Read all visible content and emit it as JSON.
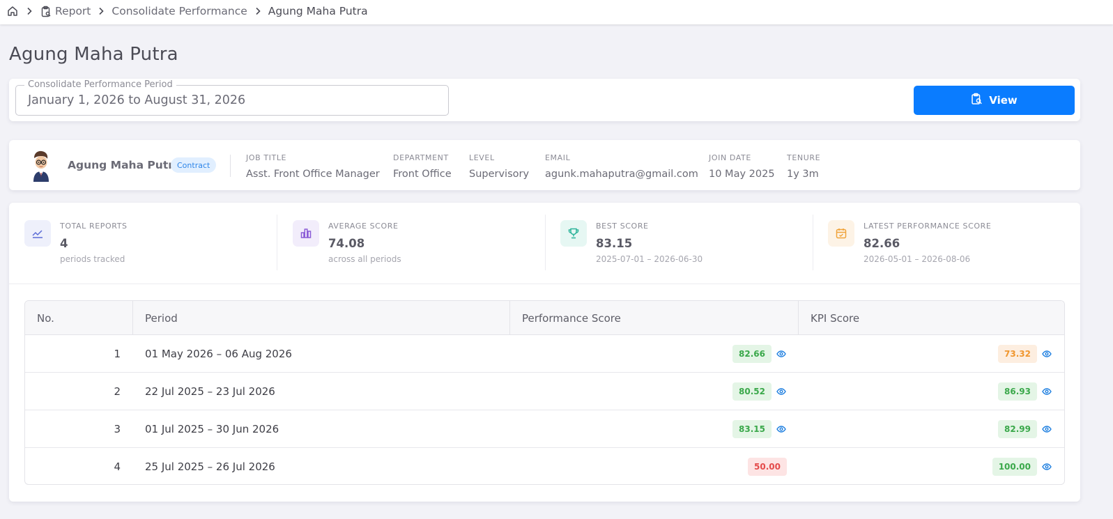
{
  "breadcrumb": {
    "items": [
      "Report",
      "Consolidate Performance",
      "Agung Maha Putra"
    ]
  },
  "page": {
    "title": "Agung Maha Putra"
  },
  "period_filter": {
    "label": "Consolidate Performance Period",
    "value": "January 1, 2026 to August 31, 2026",
    "button_label": "View"
  },
  "employee": {
    "name": "Agung Maha Putra",
    "status": "Contract",
    "fields": [
      {
        "label": "JOB TITLE",
        "value": "Asst. Front Office Manager"
      },
      {
        "label": "DEPARTMENT",
        "value": "Front Office"
      },
      {
        "label": "LEVEL",
        "value": "Supervisory"
      },
      {
        "label": "EMAIL",
        "value": "agunk.mahaputra@gmail.com"
      },
      {
        "label": "JOIN DATE",
        "value": "10 May 2025"
      },
      {
        "label": "TENURE",
        "value": "1y 3m"
      }
    ]
  },
  "stats": [
    {
      "label": "TOTAL REPORTS",
      "value": "4",
      "sub": "periods tracked",
      "icon": "trend-line-icon",
      "color": "#5b6bd6"
    },
    {
      "label": "AVERAGE SCORE",
      "value": "74.08",
      "sub": "across all periods",
      "icon": "bar-chart-icon",
      "color": "#8a5bd6"
    },
    {
      "label": "BEST SCORE",
      "value": "83.15",
      "sub": "2025-07-01 – 2026-06-30",
      "icon": "trophy-icon",
      "color": "#2bb39a"
    },
    {
      "label": "LATEST PERFORMANCE SCORE",
      "value": "82.66",
      "sub": "2026-05-01 – 2026-08-06",
      "icon": "calendar-icon",
      "color": "#f0a33a"
    }
  ],
  "table": {
    "columns": [
      "No.",
      "Period",
      "Performance Score",
      "KPI Score"
    ],
    "rows": [
      {
        "no": "1",
        "period": "01 May 2026 – 06 Aug 2026",
        "performance": "82.66",
        "performance_status": "green",
        "kpi": "73.32",
        "kpi_status": "orange"
      },
      {
        "no": "2",
        "period": "22 Jul 2025 – 23 Jul 2026",
        "performance": "80.52",
        "performance_status": "green",
        "kpi": "86.93",
        "kpi_status": "green"
      },
      {
        "no": "3",
        "period": "01 Jul 2025 – 30 Jun 2026",
        "performance": "83.15",
        "performance_status": "green",
        "kpi": "82.99",
        "kpi_status": "green"
      },
      {
        "no": "4",
        "period": "25 Jul 2025 – 26 Jul 2026",
        "performance": "50.00",
        "performance_status": "red",
        "kpi": "100.00",
        "kpi_status": "green"
      }
    ]
  },
  "colors": {
    "primary": "#0a7cff",
    "good": "#3aa84a",
    "warning": "#f0962e",
    "bad": "#e44b4b"
  }
}
